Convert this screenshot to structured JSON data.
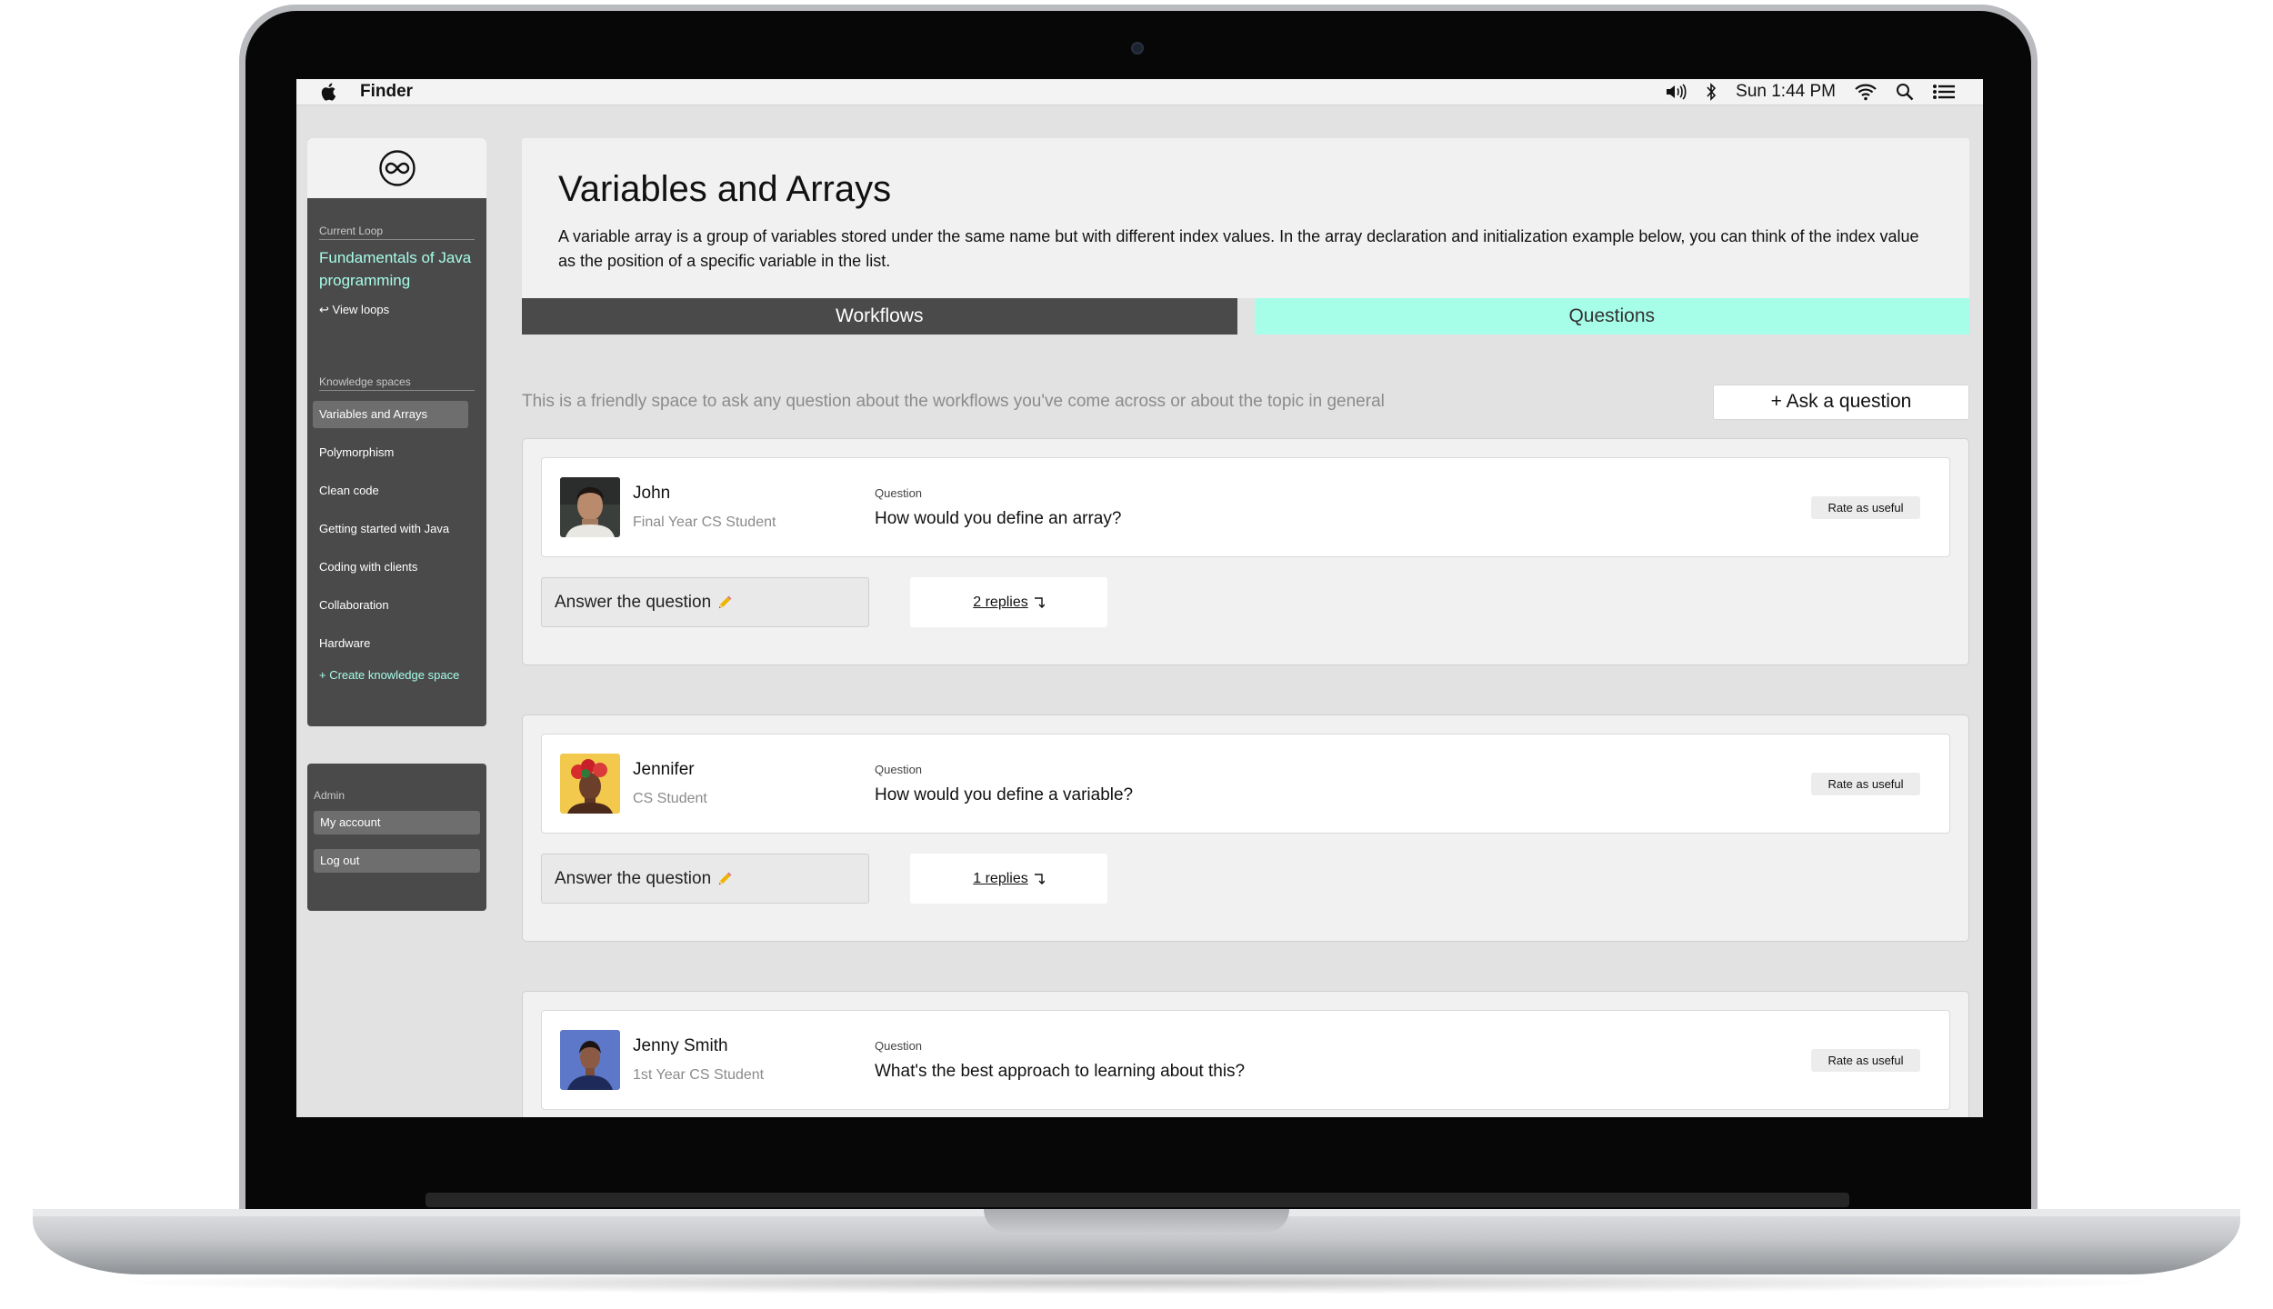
{
  "menubar": {
    "app_name": "Finder",
    "clock": "Sun 1:44 PM",
    "icons": [
      "apple-icon",
      "volume-icon",
      "bluetooth-icon",
      "wifi-icon",
      "search-icon",
      "list-icon"
    ]
  },
  "sidebar": {
    "current_loop_caption": "Current Loop",
    "current_loop": "Fundamentals of Java programming",
    "view_loops": "↩ View loops",
    "knowledge_caption": "Knowledge spaces",
    "items": [
      {
        "label": "Variables and Arrays",
        "active": true
      },
      {
        "label": "Polymorphism",
        "active": false
      },
      {
        "label": "Clean code",
        "active": false
      },
      {
        "label": "Getting started with Java",
        "active": false
      },
      {
        "label": "Coding with clients",
        "active": false
      },
      {
        "label": "Collaboration",
        "active": false
      },
      {
        "label": "Hardware",
        "active": false
      }
    ],
    "create_label": "+ Create knowledge space"
  },
  "admin": {
    "caption": "Admin",
    "my_account": "My account",
    "log_out": "Log out"
  },
  "main": {
    "title": "Variables and Arrays",
    "description": "A variable array is a group of variables stored under the same name but with different index values. In the array declaration and initialization example below, you can think of the index value as the position of a specific variable in the list.",
    "tabs": [
      {
        "label": "Workflows",
        "active": false
      },
      {
        "label": "Questions",
        "active": true
      }
    ],
    "intro": "This is a friendly space to ask any question about the workflows you've come across or about the topic in general",
    "ask_button": "+ Ask a question",
    "question_label": "Question",
    "rate_label": "Rate as useful",
    "answer_label": "Answer the question",
    "questions": [
      {
        "name": "John",
        "role": "Final Year CS Student",
        "question": "How would you define an array?",
        "replies": "2 replies"
      },
      {
        "name": "Jennifer",
        "role": "CS Student",
        "question": "How would you define a variable?",
        "replies": "1 replies"
      },
      {
        "name": "Jenny Smith",
        "role": "1st Year CS Student",
        "question": "What's the best approach to learning about this?",
        "replies": ""
      }
    ]
  },
  "colors": {
    "accent": "#a6fde8",
    "sidebar_bg": "#4a4a4a",
    "screen_bg": "#e2e2e2"
  }
}
